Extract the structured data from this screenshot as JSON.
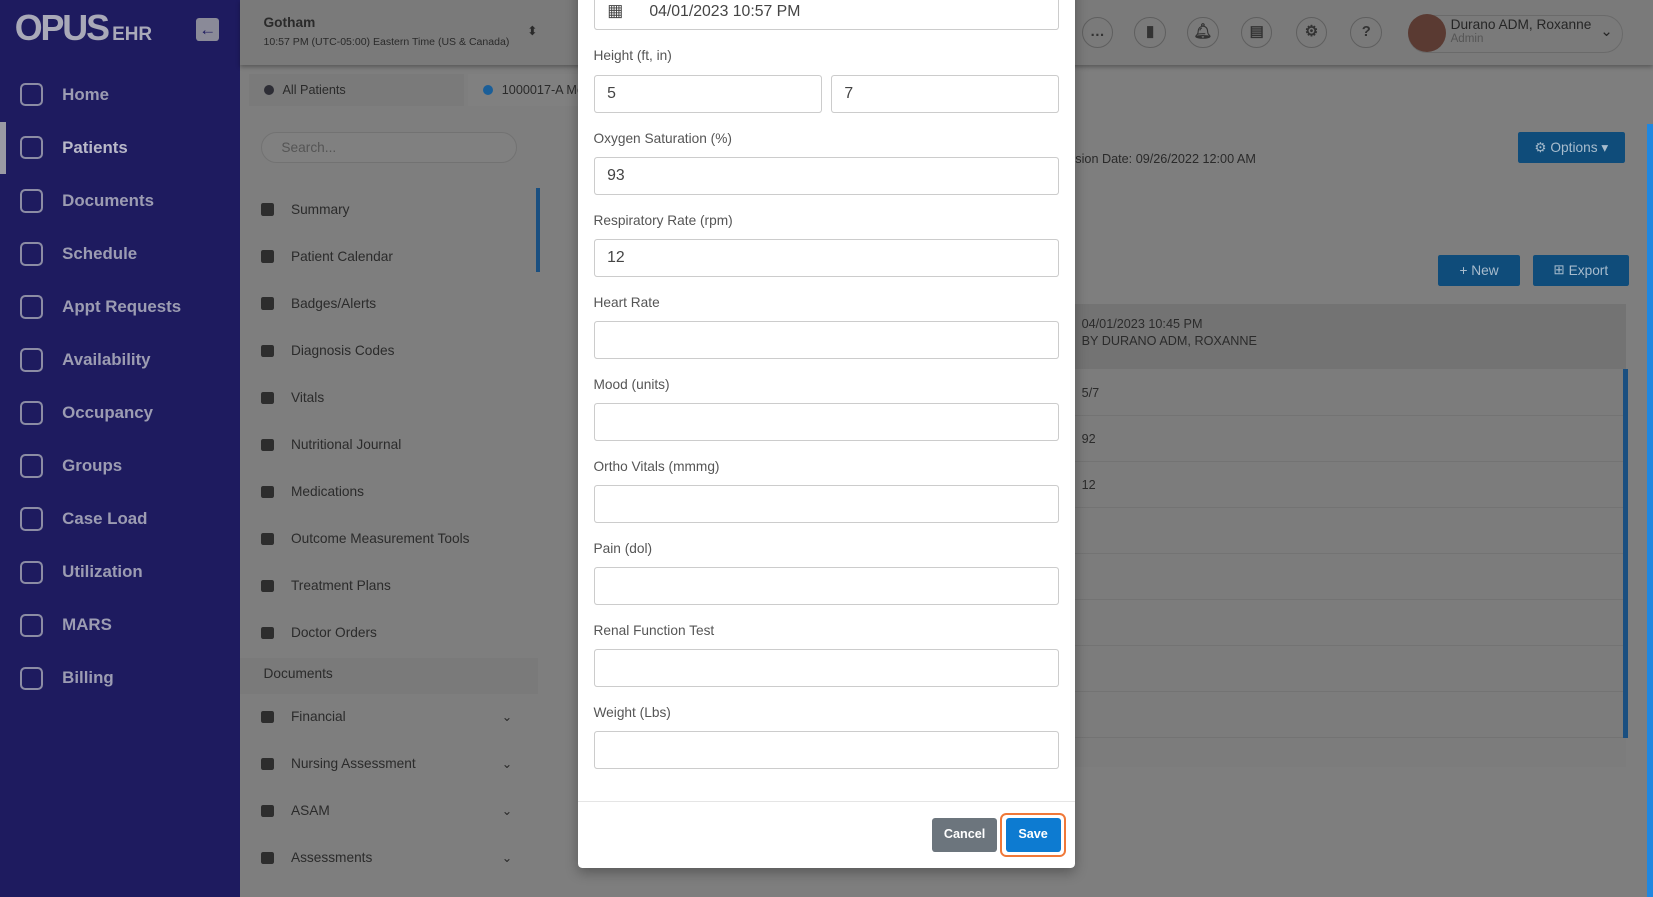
{
  "brand": {
    "logo": "OPUS",
    "logo_suffix": "EHR"
  },
  "sidebar": {
    "items": [
      {
        "label": "Home",
        "icon": "home-icon"
      },
      {
        "label": "Patients",
        "icon": "users-icon",
        "active": true
      },
      {
        "label": "Documents",
        "icon": "documents-icon"
      },
      {
        "label": "Schedule",
        "icon": "calendar-icon"
      },
      {
        "label": "Appt Requests",
        "icon": "clock-icon"
      },
      {
        "label": "Availability",
        "icon": "availability-icon"
      },
      {
        "label": "Occupancy",
        "icon": "bed-icon"
      },
      {
        "label": "Groups",
        "icon": "groups-icon"
      },
      {
        "label": "Case Load",
        "icon": "caseload-icon"
      },
      {
        "label": "Utilization",
        "icon": "clipboard-icon"
      },
      {
        "label": "MARS",
        "icon": "pills-icon"
      },
      {
        "label": "Billing",
        "icon": "billing-icon"
      }
    ]
  },
  "header": {
    "location": "Gotham",
    "timezone": "10:57 PM (UTC-05:00) Eastern Time (US & Canada)",
    "user_name": "Durano ADM, Roxanne",
    "user_role": "Admin"
  },
  "tabs": [
    {
      "label": "All Patients"
    },
    {
      "label": "1000017-A Mo"
    }
  ],
  "search": {
    "placeholder": "Search..."
  },
  "patient_menu": [
    {
      "label": "Summary"
    },
    {
      "label": "Patient Calendar"
    },
    {
      "label": "Badges/Alerts"
    },
    {
      "label": "Diagnosis Codes"
    },
    {
      "label": "Vitals"
    },
    {
      "label": "Nutritional Journal"
    },
    {
      "label": "Medications"
    },
    {
      "label": "Outcome Measurement Tools"
    },
    {
      "label": "Treatment Plans"
    },
    {
      "label": "Doctor Orders"
    }
  ],
  "documents_section": "Documents",
  "document_folders": [
    {
      "label": "Financial"
    },
    {
      "label": "Nursing Assessment"
    },
    {
      "label": "ASAM"
    },
    {
      "label": "Assessments"
    }
  ],
  "main": {
    "admission": "sion Date: 09/26/2022 12:00 AM",
    "options_label": "Options",
    "new_label": "New",
    "export_label": "Export",
    "record_header": {
      "date": "04/01/2023 10:45 PM",
      "by": "BY DURANO ADM, ROXANNE"
    },
    "record_values": [
      "5/7",
      "92",
      "12"
    ]
  },
  "modal": {
    "date_value": "04/01/2023 10:57 PM",
    "fields": [
      {
        "label": "Height (ft, in)",
        "values": [
          "5",
          "7"
        ]
      },
      {
        "label": "Oxygen Saturation (%)",
        "value": "93"
      },
      {
        "label": "Respiratory Rate (rpm)",
        "value": "12"
      },
      {
        "label": "Heart Rate",
        "value": ""
      },
      {
        "label": "Mood (units)",
        "value": ""
      },
      {
        "label": "Ortho Vitals (mmmg)",
        "value": ""
      },
      {
        "label": "Pain (dol)",
        "value": ""
      },
      {
        "label": "Renal Function Test",
        "value": ""
      },
      {
        "label": "Weight (Lbs)",
        "value": ""
      }
    ],
    "cancel_label": "Cancel",
    "save_label": "Save"
  }
}
